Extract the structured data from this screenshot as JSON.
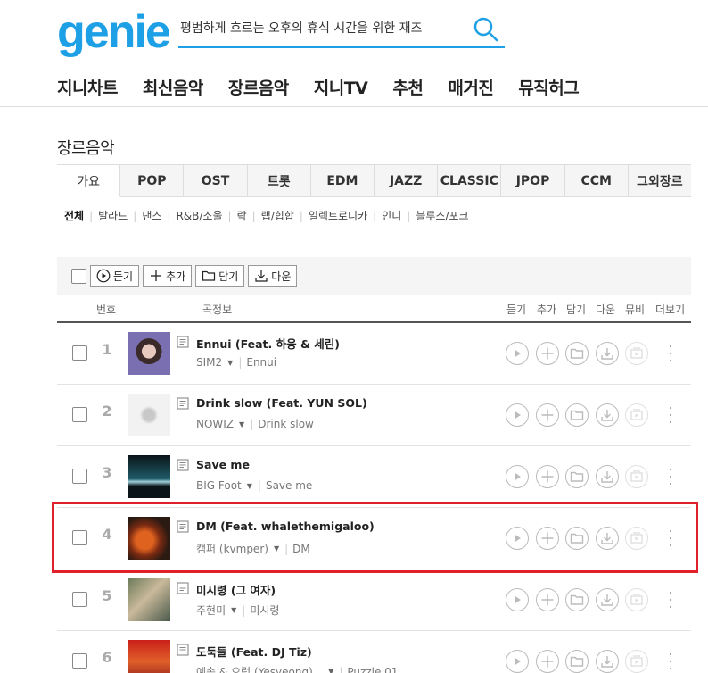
{
  "header": {
    "logo": "genie",
    "search_placeholder": "평범하게 흐르는 오후의 휴식 시간을 위한 재즈",
    "nav": [
      "지니차트",
      "최신음악",
      "장르음악",
      "지니TV",
      "추천",
      "매거진",
      "뮤직허그"
    ]
  },
  "section_title": "장르음악",
  "genre_tabs": [
    "가요",
    "POP",
    "OST",
    "트롯",
    "EDM",
    "JAZZ",
    "CLASSIC",
    "JPOP",
    "CCM",
    "그외장르"
  ],
  "active_genre": "가요",
  "sub_genres": [
    "전체",
    "발라드",
    "댄스",
    "R&B/소울",
    "락",
    "랩/힙합",
    "일렉트로니카",
    "인디",
    "블루스/포크"
  ],
  "toolbar": {
    "listen": "듣기",
    "add": "추가",
    "save": "담기",
    "download": "다운"
  },
  "columns": {
    "number": "번호",
    "song_info": "곡정보",
    "listen": "듣기",
    "add": "추가",
    "save": "담기",
    "download": "다운",
    "video": "뮤비",
    "more": "더보기"
  },
  "songs": [
    {
      "rank": "1",
      "title": "Ennui (Feat. 하웅 & 세린)",
      "artist": "SIM2",
      "album": "Ennui"
    },
    {
      "rank": "2",
      "title": "Drink slow (Feat. YUN SOL)",
      "artist": "NOWIZ",
      "album": "Drink slow"
    },
    {
      "rank": "3",
      "title": "Save me",
      "artist": "BIG Foot",
      "album": "Save me"
    },
    {
      "rank": "4",
      "title": "DM (Feat. whalethemigaloo)",
      "artist": "캠퍼 (kvmper)",
      "album": "DM"
    },
    {
      "rank": "5",
      "title": "미시령 (그 여자)",
      "artist": "주현미",
      "album": "미시령"
    },
    {
      "rank": "6",
      "title": "도둑들 (Feat. DJ Tiz)",
      "artist": "예송 & 으렁 (Yesyeong)...",
      "album": "Puzzle 01"
    }
  ],
  "colors": {
    "brand": "#1ea0e6",
    "highlight": "#e0202a"
  }
}
